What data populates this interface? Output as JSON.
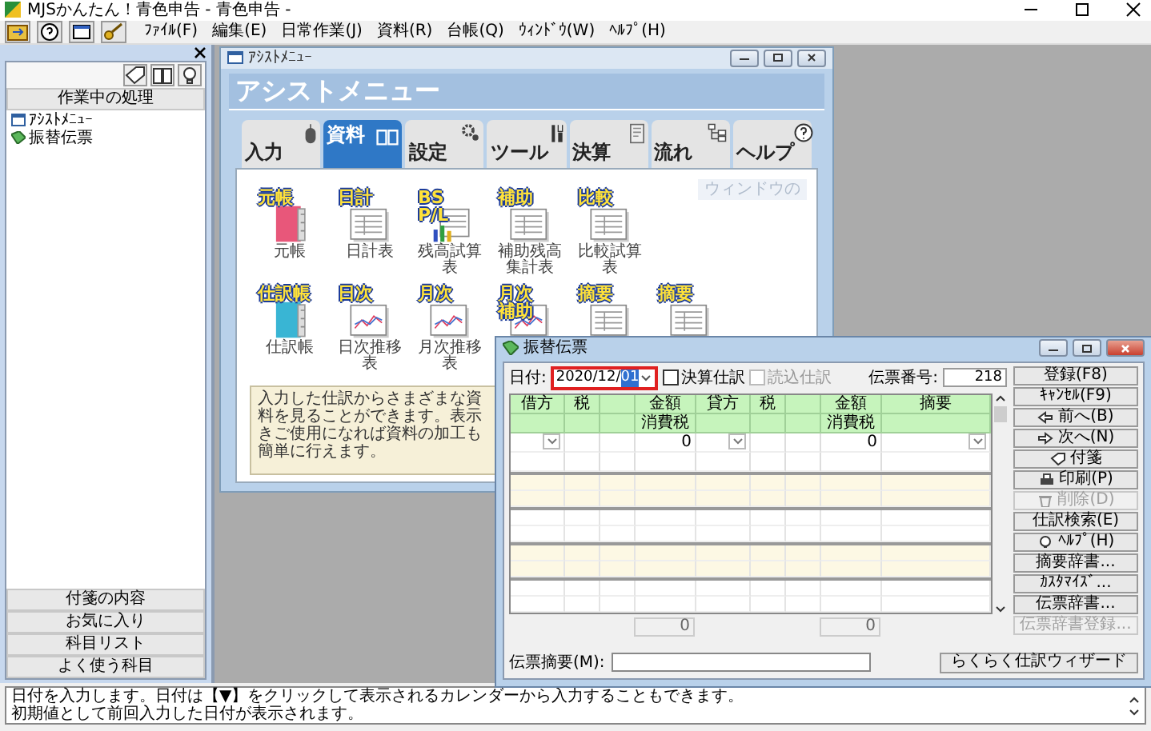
{
  "window": {
    "title": "MJSかんたん！青色申告 - 青色申告 -"
  },
  "menu": [
    "ﾌｧｲﾙ(F)",
    "編集(E)",
    "日常作業(J)",
    "資料(R)",
    "台帳(Q)",
    "ｳｨﾝﾄﾞｳ(W)",
    "ﾍﾙﾌﾟ(H)"
  ],
  "side_panel": {
    "header": "作業中の処理",
    "items": [
      {
        "label": "ｱｼｽﾄﾒﾆｭｰ",
        "kind": "menu"
      },
      {
        "label": "振替伝票",
        "kind": "voucher"
      }
    ],
    "sections": [
      "付箋の内容",
      "お気に入り",
      "科目リスト",
      "よく使う科目"
    ]
  },
  "assist_menu": {
    "title": "ｱｼｽﾄﾒﾆｭｰ",
    "heading": "アシストメニュー",
    "tabs": [
      {
        "label": "入力",
        "kind": "mouse",
        "selected": false
      },
      {
        "label": "資料",
        "kind": "book",
        "selected": true
      },
      {
        "label": "設定",
        "kind": "gears",
        "selected": false
      },
      {
        "label": "ツール",
        "kind": "tools",
        "selected": false
      },
      {
        "label": "決算",
        "kind": "document",
        "selected": false
      },
      {
        "label": "流れ",
        "kind": "flow",
        "selected": false
      },
      {
        "label": "ヘルプ",
        "kind": "help",
        "selected": false
      }
    ],
    "hint": "ウィンドウの",
    "report_rows": [
      [
        {
          "badge": [
            "元帳"
          ],
          "label": "元帳",
          "kind": "book",
          "color": "#e8577a"
        },
        {
          "badge": [
            "日計"
          ],
          "label": "日計表",
          "kind": "sheet"
        },
        {
          "badge": [
            "BS",
            "P/L"
          ],
          "label": "残高試算表",
          "kind": "bspl"
        },
        {
          "badge": [
            "補助"
          ],
          "label": "補助残高集計表",
          "kind": "sheet"
        },
        {
          "badge": [
            "比較"
          ],
          "label": "比較試算表",
          "kind": "sheet"
        }
      ],
      [
        {
          "badge": [
            "仕訳帳"
          ],
          "label": "仕訳帳",
          "kind": "book",
          "color": "#39b5d4"
        },
        {
          "badge": [
            "日次"
          ],
          "label": "日次推移表",
          "kind": "chart"
        },
        {
          "badge": [
            "月次"
          ],
          "label": "月次推移表",
          "kind": "chart"
        },
        {
          "badge": [
            "月次",
            "補助"
          ],
          "kind": "chart"
        },
        {
          "badge": [
            "摘要"
          ],
          "kind": "sheet"
        },
        {
          "badge": [
            "摘要"
          ],
          "kind": "sheet"
        }
      ]
    ],
    "description": [
      "入力した仕訳からさまざまな資料を見ることができます。表示",
      "きご使用になれば資料の加工も簡単に行えます。"
    ]
  },
  "journal": {
    "title": "振替伝票",
    "date_label": "日付:",
    "date": {
      "text": "2020/12/",
      "selected_text": "01"
    },
    "checks": [
      {
        "label": "決算仕訳",
        "checked": false,
        "disabled": false
      },
      {
        "label": "読込仕訳",
        "checked": false,
        "disabled": true
      }
    ],
    "voucher_no_label": "伝票番号:",
    "voucher_no": "218",
    "columns": [
      {
        "kind": "account",
        "label": "借方"
      },
      {
        "kind": "tax",
        "label": "税"
      },
      {
        "kind": "blank"
      },
      {
        "kind": "amount",
        "label": "金額",
        "sub": "消費税"
      },
      {
        "kind": "account",
        "label": "貸方"
      },
      {
        "kind": "tax",
        "label": "税"
      },
      {
        "kind": "blank"
      },
      {
        "kind": "amount",
        "label": "金額",
        "sub": "消費税"
      },
      {
        "kind": "memo",
        "label": "摘要"
      }
    ],
    "entry_amounts": [
      "0",
      "0"
    ],
    "totals": [
      "0",
      "0"
    ],
    "buttons": [
      {
        "label": "登録(F8)",
        "kind": "plain",
        "disabled": false
      },
      {
        "label": "ｷｬﾝｾﾙ(F9)",
        "kind": "plain",
        "disabled": false
      },
      {
        "label": "前へ(B)",
        "kind": "prev",
        "disabled": false
      },
      {
        "label": "次へ(N)",
        "kind": "next",
        "disabled": false
      },
      {
        "label": "付箋",
        "kind": "tag",
        "disabled": false
      },
      {
        "label": "印刷(P)",
        "kind": "print",
        "disabled": false
      },
      {
        "label": "削除(D)",
        "kind": "delete",
        "disabled": true
      },
      {
        "label": "仕訳検索(E)",
        "kind": "plain",
        "disabled": false
      },
      {
        "label": "ﾍﾙﾌﾟ(H)",
        "kind": "help",
        "disabled": false
      },
      {
        "label": "摘要辞書...",
        "kind": "plain",
        "disabled": false
      },
      {
        "label": "ｶｽﾀﾏｲｽﾞ...",
        "kind": "plain",
        "disabled": false
      },
      {
        "label": "伝票辞書...",
        "kind": "plain",
        "disabled": false
      },
      {
        "label": "伝票辞書登録...",
        "kind": "plain",
        "disabled": true
      }
    ],
    "memo_label": "伝票摘要(M):",
    "wizard_button": "らくらく仕訳ウィザード"
  },
  "status_bar": [
    "日付を入力します。日付は【▼】をクリックして表示されるカレンダーから入力することもできます。",
    "初期値として前回入力した日付が表示されます。"
  ]
}
